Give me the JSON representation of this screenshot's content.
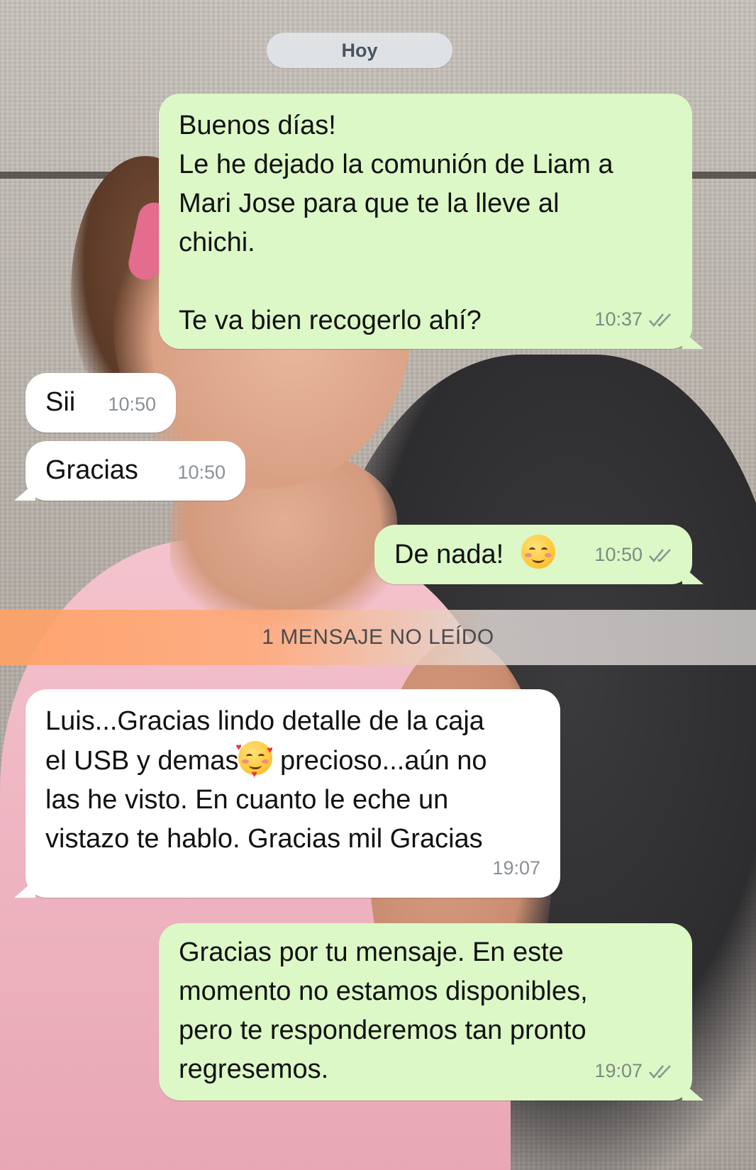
{
  "chat": {
    "date_chip": "Hoy",
    "unread_banner": "1 MENSAJE NO LEÍDO",
    "messages": [
      {
        "direction": "outgoing",
        "text": "Buenos días!\nLe he dejado la comunión de Liam a\nMari Jose para que te la lleve al\nchichi.\n\nTe va bien recogerlo ahí?",
        "time": "10:37",
        "status": "read-double-check"
      },
      {
        "direction": "incoming",
        "text": "Sii",
        "time": "10:50"
      },
      {
        "direction": "incoming",
        "text": "Gracias",
        "time": "10:50"
      },
      {
        "direction": "outgoing",
        "text": "De nada!",
        "emoji": "smiling-face-emoji",
        "time": "10:50",
        "status": "read-double-check"
      },
      {
        "direction": "incoming",
        "text_line1": "Luis...Gracias lindo detalle de la caja",
        "text_line2a": "el USB y demas",
        "emoji": "smiling-face-with-hearts-emoji",
        "text_line2b": " precioso...aún no",
        "text_rest": "las he visto. En cuanto le eche un\nvistazo te hablo. Gracias mil Gracias",
        "time": "19:07"
      },
      {
        "direction": "outgoing",
        "text": "Gracias por tu mensaje. En este\nmomento no estamos disponibles,\npero te responderemos tan pronto\nregresemos.",
        "time": "19:07",
        "status": "read-double-check"
      }
    ]
  },
  "colors": {
    "outgoing_bubble": "#dcf8c6",
    "incoming_bubble": "#ffffff",
    "unread_banner": "#ffa166",
    "meta_text": "#7d8a84"
  }
}
